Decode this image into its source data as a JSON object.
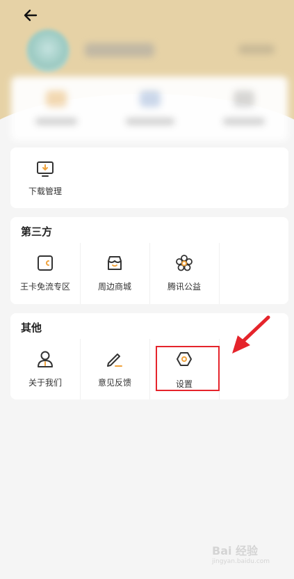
{
  "colors": {
    "header_bg": "#e6d2a6",
    "accent_orange": "#f0a23b",
    "highlight_red": "#e5242b"
  },
  "header": {
    "back_icon": "arrow-left-icon"
  },
  "download_section": {
    "items": [
      {
        "label": "下载管理",
        "icon": "monitor-download-icon"
      }
    ]
  },
  "third_party": {
    "title": "第三方",
    "items": [
      {
        "label": "王卡免流专区",
        "icon": "card-icon"
      },
      {
        "label": "周边商城",
        "icon": "store-icon"
      },
      {
        "label": "腾讯公益",
        "icon": "flower-icon"
      }
    ]
  },
  "other": {
    "title": "其他",
    "items": [
      {
        "label": "关于我们",
        "icon": "person-icon"
      },
      {
        "label": "意见反馈",
        "icon": "pencil-icon"
      },
      {
        "label": "设置",
        "icon": "settings-hexagon-icon"
      }
    ]
  },
  "watermark": {
    "text": "Bai 经验",
    "sub": "jingyan.baidu.com"
  }
}
